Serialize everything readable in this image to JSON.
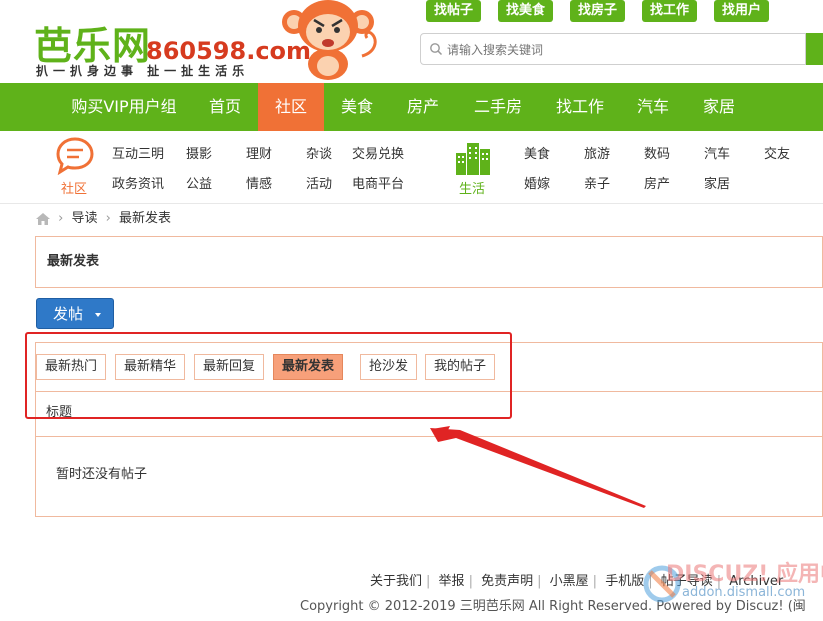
{
  "logo": {
    "brand": "芭乐网",
    "domain": "860598.com",
    "slogan": "扒一扒身边事  扯一扯生活乐"
  },
  "quick_links": [
    "找帖子",
    "找美食",
    "找房子",
    "找工作",
    "找用户"
  ],
  "search": {
    "placeholder": "请输入搜索关键词"
  },
  "main_nav": [
    "购买VIP用户组",
    "首页",
    "社区",
    "美食",
    "房产",
    "二手房",
    "找工作",
    "汽车",
    "家居"
  ],
  "main_nav_active": "社区",
  "community": {
    "label": "社区",
    "links_row1": [
      "互动三明",
      "摄影",
      "理财",
      "杂谈",
      "交易兑换"
    ],
    "links_row2": [
      "政务资讯",
      "公益",
      "情感",
      "活动",
      "电商平台"
    ]
  },
  "life": {
    "label": "生活",
    "links_row1": [
      "美食",
      "旅游",
      "数码",
      "汽车",
      "交友"
    ],
    "links_row2": [
      "婚嫁",
      "亲子",
      "房产",
      "家居"
    ]
  },
  "breadcrumb": {
    "items": [
      "导读",
      "最新发表"
    ]
  },
  "page_title": "最新发表",
  "post_button": "发帖",
  "tabs": [
    "最新热门",
    "最新精华",
    "最新回复",
    "最新发表",
    "抢沙发",
    "我的帖子"
  ],
  "active_tab": "最新发表",
  "table_header": "标题",
  "empty_message": "暂时还没有帖子",
  "footer": {
    "links": [
      "关于我们",
      "举报",
      "免责声明",
      "小黑屋",
      "手机版",
      "帖子导读",
      "Archiver"
    ],
    "copyright": "Copyright © 2012-2019 三明芭乐网 All Right Reserved. Powered by Discuz! (闽"
  },
  "watermark": {
    "logo": "DISCUZ! 应用中心",
    "url": "addon.dismall.com"
  },
  "colors": {
    "brand_green": "#5fb21a",
    "active_orange": "#f07136",
    "tab_active": "#f7a07a",
    "panel_border": "#f0b99e",
    "post_button_blue": "#2f79c8",
    "annotation_red": "#e02424",
    "community_icon": "#f07136",
    "life_icon": "#5fb21a"
  }
}
